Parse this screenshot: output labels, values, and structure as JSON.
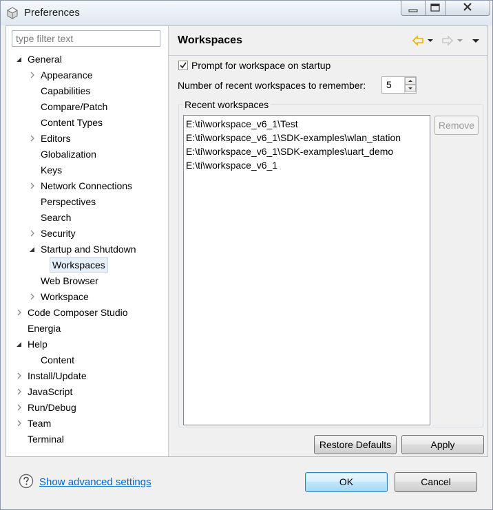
{
  "window": {
    "title": "Preferences",
    "controls": [
      "minimize-icon",
      "maximize-icon",
      "close-icon"
    ]
  },
  "filter": {
    "placeholder": "type filter text"
  },
  "tree": [
    {
      "label": "General",
      "level": 0,
      "twisty": "expanded"
    },
    {
      "label": "Appearance",
      "level": 1,
      "twisty": "collapsed"
    },
    {
      "label": "Capabilities",
      "level": 1,
      "twisty": "none"
    },
    {
      "label": "Compare/Patch",
      "level": 1,
      "twisty": "none"
    },
    {
      "label": "Content Types",
      "level": 1,
      "twisty": "none"
    },
    {
      "label": "Editors",
      "level": 1,
      "twisty": "collapsed"
    },
    {
      "label": "Globalization",
      "level": 1,
      "twisty": "none"
    },
    {
      "label": "Keys",
      "level": 1,
      "twisty": "none"
    },
    {
      "label": "Network Connections",
      "level": 1,
      "twisty": "collapsed"
    },
    {
      "label": "Perspectives",
      "level": 1,
      "twisty": "none"
    },
    {
      "label": "Search",
      "level": 1,
      "twisty": "none"
    },
    {
      "label": "Security",
      "level": 1,
      "twisty": "collapsed"
    },
    {
      "label": "Startup and Shutdown",
      "level": 1,
      "twisty": "expanded"
    },
    {
      "label": "Workspaces",
      "level": 2,
      "twisty": "none",
      "selected": true
    },
    {
      "label": "Web Browser",
      "level": 1,
      "twisty": "none"
    },
    {
      "label": "Workspace",
      "level": 1,
      "twisty": "collapsed"
    },
    {
      "label": "Code Composer Studio",
      "level": 0,
      "twisty": "collapsed"
    },
    {
      "label": "Energia",
      "level": 0,
      "twisty": "none"
    },
    {
      "label": "Help",
      "level": 0,
      "twisty": "expanded"
    },
    {
      "label": "Content",
      "level": 1,
      "twisty": "none"
    },
    {
      "label": "Install/Update",
      "level": 0,
      "twisty": "collapsed"
    },
    {
      "label": "JavaScript",
      "level": 0,
      "twisty": "collapsed"
    },
    {
      "label": "Run/Debug",
      "level": 0,
      "twisty": "collapsed"
    },
    {
      "label": "Team",
      "level": 0,
      "twisty": "collapsed"
    },
    {
      "label": "Terminal",
      "level": 0,
      "twisty": "none"
    }
  ],
  "page": {
    "title": "Workspaces",
    "prompt_label": "Prompt for workspace on startup",
    "prompt_checked": true,
    "recent_count_label": "Number of recent workspaces to remember:",
    "recent_count_value": "5",
    "recent_group_title": "Recent workspaces",
    "recent_workspaces": [
      "E:\\ti\\workspace_v6_1\\Test",
      "E:\\ti\\workspace_v6_1\\SDK-examples\\wlan_station",
      "E:\\ti\\workspace_v6_1\\SDK-examples\\uart_demo",
      "E:\\ti\\workspace_v6_1"
    ],
    "remove_label": "Remove",
    "restore_defaults_label": "Restore Defaults",
    "apply_label": "Apply"
  },
  "footer": {
    "advanced_link": "Show advanced settings",
    "ok_label": "OK",
    "cancel_label": "Cancel"
  },
  "colors": {
    "accent": "#0066cc",
    "selection": "#e5f0fb",
    "back_arrow": "#e8b400",
    "forward_arrow": "#c8c8c8"
  }
}
